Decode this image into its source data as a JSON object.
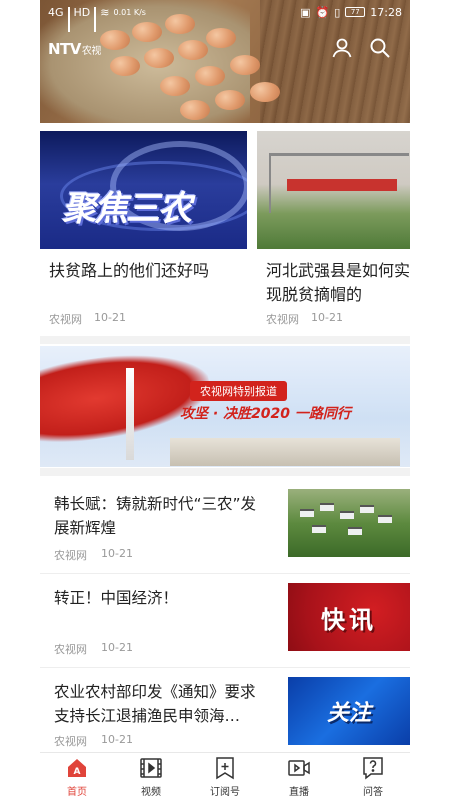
{
  "status_bar": {
    "carrier_left": "4G",
    "carrier_mid": "HD",
    "speed": "0.01 K/s",
    "battery": "77",
    "time": "17:28"
  },
  "header": {
    "logo_main": "NTV",
    "logo_sub": "农视"
  },
  "carousel": [
    {
      "image_text": "聚焦三农",
      "title": "扶贫路上的他们还好吗",
      "source": "农视网",
      "date": "10-21"
    },
    {
      "image_text": "",
      "title": "河北武强县是如何实现脱贫摘帽的",
      "source": "农视网",
      "date": "10-21"
    }
  ],
  "banner": {
    "tag": "农视网特别报道",
    "slogan": "攻坚 · 决胜2020 一路同行"
  },
  "news": [
    {
      "title": "韩长赋：铸就新时代“三农”发展新辉煌",
      "source": "农视网",
      "date": "10-21",
      "thumb_text": ""
    },
    {
      "title": "转正！中国经济！",
      "source": "农视网",
      "date": "10-21",
      "thumb_text": "快讯"
    },
    {
      "title": "农业农村部印发《通知》要求支持长江退捕渔民申领海…",
      "source": "农视网",
      "date": "10-21",
      "thumb_text": "关注"
    }
  ],
  "bottom_nav": [
    {
      "label": "首页",
      "icon": "home-icon",
      "active": true
    },
    {
      "label": "视频",
      "icon": "video-icon",
      "active": false
    },
    {
      "label": "订阅号",
      "icon": "subscribe-icon",
      "active": false
    },
    {
      "label": "直播",
      "icon": "live-icon",
      "active": false
    },
    {
      "label": "问答",
      "icon": "qa-icon",
      "active": false
    }
  ],
  "colors": {
    "accent": "#e0443a",
    "text": "#222222",
    "meta": "#999999"
  }
}
